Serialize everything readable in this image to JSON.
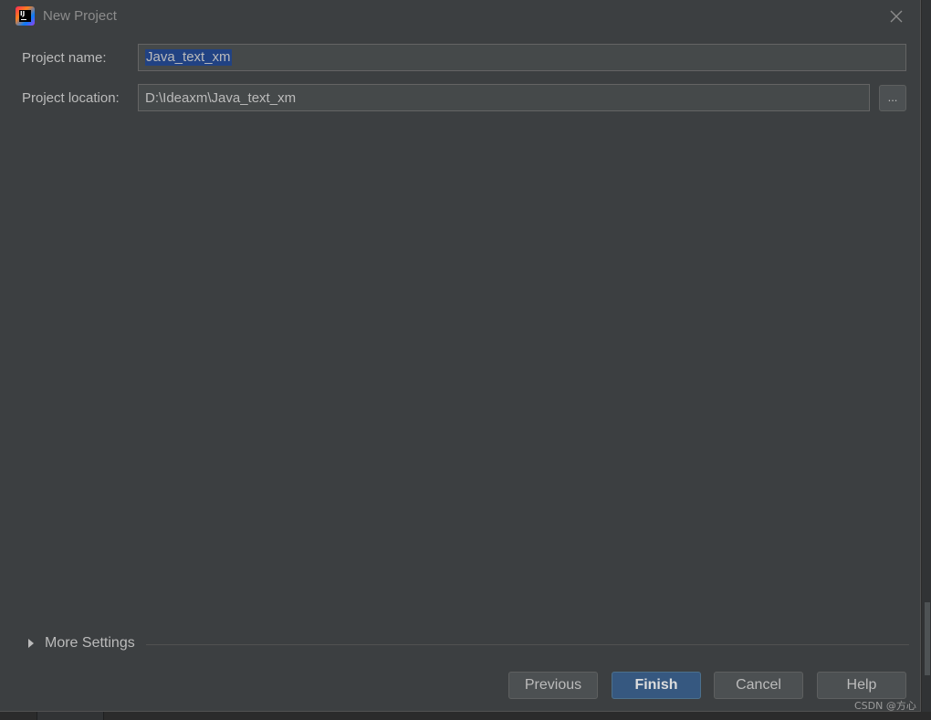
{
  "dialog": {
    "title": "New Project",
    "close_icon": "close-icon"
  },
  "form": {
    "project_name_label": "Project name:",
    "project_name_value": "Java_text_xm",
    "project_location_label": "Project location:",
    "project_location_value": "D:\\Ideaxm\\Java_text_xm",
    "browse_label": "..."
  },
  "more_settings": {
    "label": "More Settings",
    "icon": "triangle-right-icon"
  },
  "footer": {
    "previous_label": "Previous",
    "finish_label": "Finish",
    "cancel_label": "Cancel",
    "help_label": "Help"
  },
  "watermark": "CSDN @方心",
  "colors": {
    "dialog_bg": "#3c3f41",
    "field_bg": "#45494a",
    "selection": "#214283",
    "primary_button": "#365880",
    "text": "#bbbbbb"
  }
}
